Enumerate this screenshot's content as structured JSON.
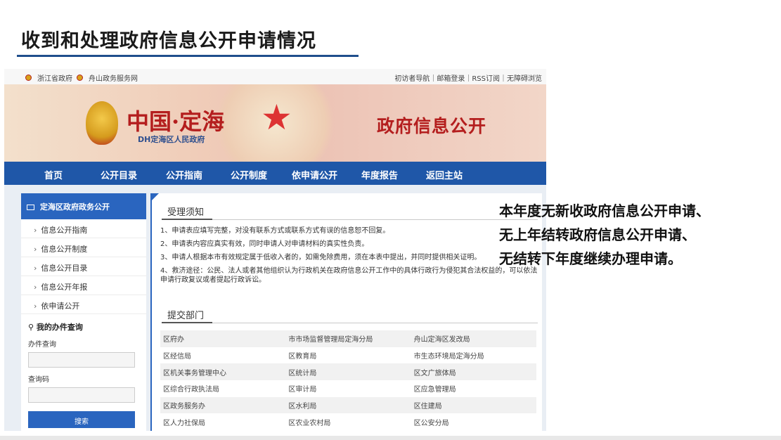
{
  "slide": {
    "title": "收到和处理政府信息公开申请情况",
    "note_lines": [
      "本年度无新收政府信息公开申请、",
      "无上年结转政府信息公开申请、",
      "无结转下年度继续办理申请。"
    ]
  },
  "topbar": {
    "left_links": [
      "浙江省政府",
      "舟山政务服务网"
    ],
    "right_links": "初访者导航｜邮箱登录｜RSS订阅｜无障碍浏览"
  },
  "banner": {
    "brand": "中国·定海",
    "brand_sub": "DH定海区人民政府",
    "gov_title": "政府信息公开"
  },
  "nav": [
    "首页",
    "公开目录",
    "公开指南",
    "公开制度",
    "依申请公开",
    "年度报告",
    "返回主站"
  ],
  "sidebar": {
    "header": "定海区政府政务公开",
    "items": [
      "信息公开指南",
      "信息公开制度",
      "信息公开目录",
      "信息公开年报",
      "依申请公开"
    ],
    "query_title": "我的办件查询",
    "label1": "办件查询",
    "label2": "查询码",
    "search_button": "搜索"
  },
  "main": {
    "section1_title": "受理须知",
    "notices": [
      "1、申请表应填写完整，对没有联系方式或联系方式有误的信息恕不回复。",
      "2、申请表内容应真实有效，同时申请人对申请材料的真实性负责。",
      "3、申请人根据本市有效规定属于低收入者的，如需免除费用，须在本表中提出，并同时提供相关证明。",
      "4、救济途径：公民、法人或者其他组织认为行政机关在政府信息公开工作中的具体行政行为侵犯其合法权益的，可以依法申请行政复议或者提起行政诉讼。"
    ],
    "section2_title": "提交部门",
    "departments": [
      [
        "区府办",
        "市市场监督管理局定海分局",
        "舟山定海区发改局"
      ],
      [
        "区经信局",
        "区教育局",
        "市生态环境局定海分局"
      ],
      [
        "区机关事务管理中心",
        "区统计局",
        "区文广旅体局"
      ],
      [
        "区综合行政执法局",
        "区审计局",
        "区应急管理局"
      ],
      [
        "区政务服务办",
        "区水利局",
        "区住建局"
      ],
      [
        "区人力社保局",
        "区农业农村局",
        "区公安分局"
      ]
    ]
  },
  "colors": {
    "nav_blue": "#1f57a8",
    "side_blue": "#2a65bf",
    "brand_red": "#b41e1e"
  }
}
